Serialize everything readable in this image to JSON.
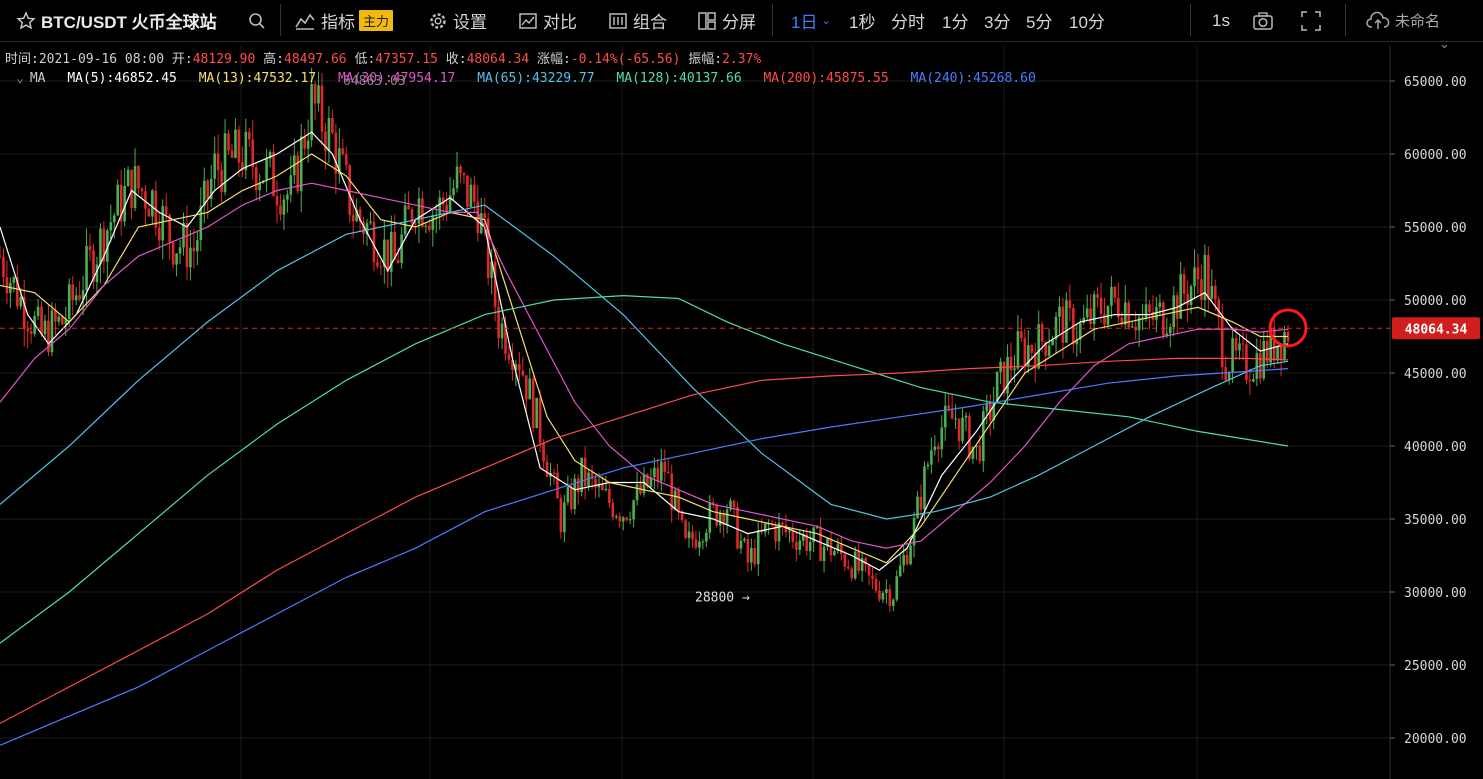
{
  "toolbar": {
    "symbol": "BTC/USDT 火币全球站",
    "indicator_label": "指标",
    "indicator_badge": "主力",
    "settings_label": "设置",
    "compare_label": "对比",
    "combine_label": "组合",
    "split_label": "分屏",
    "intervals": [
      "1日",
      "1秒",
      "分时",
      "1分",
      "3分",
      "5分",
      "10分"
    ],
    "active_interval": "1日",
    "refresh_label": "1s",
    "cloud_label": "未命名"
  },
  "info": {
    "time_label": "时间:",
    "time": "2021-09-16 08:00",
    "open_label": "开:",
    "open": "48129.90",
    "high_label": "高:",
    "high": "48497.66",
    "low_label": "低:",
    "low": "47357.15",
    "close_label": "收:",
    "close": "48064.34",
    "change_label": "涨幅:",
    "change": "-0.14%(-65.56)",
    "amp_label": "振幅:",
    "amp": "2.37%"
  },
  "ma_legend": {
    "title": "MA",
    "items": [
      {
        "label": "MA(5):46852.45",
        "color": "#ffffff"
      },
      {
        "label": "MA(13):47532.17",
        "color": "#f5e06e"
      },
      {
        "label": "MA(30):47954.17",
        "color": "#e056c8"
      },
      {
        "label": "MA(65):43229.77",
        "color": "#4fc3e8"
      },
      {
        "label": "MA(128):40137.66",
        "color": "#4fe0a0"
      },
      {
        "label": "MA(200):45875.55",
        "color": "#ff4a4a"
      },
      {
        "label": "MA(240):45268.60",
        "color": "#4a7cff"
      }
    ]
  },
  "colors": {
    "up": "#4caf50",
    "down": "#e02828",
    "grid": "#1d1d1d",
    "current_price": "#e02828"
  },
  "chart_data": {
    "type": "candlestick",
    "y_axis_ticks": [
      20000,
      25000,
      30000,
      35000,
      40000,
      45000,
      50000,
      55000,
      60000,
      65000
    ],
    "y_axis_labels": [
      "20000.00",
      "25000.00",
      "30000.00",
      "35000.00",
      "40000.00",
      "45000.00",
      "50000.00",
      "55000.00",
      "60000.00",
      "65000.00"
    ],
    "ylim": [
      17700,
      67800
    ],
    "current_price": 48064.34,
    "current_price_label": "48064.34",
    "min_marker": {
      "label": "28800 →",
      "value": 28800
    },
    "max_marker": {
      "label": "64863.03",
      "value": 64863
    },
    "ohlc_ref": [
      [
        0,
        53000
      ],
      [
        6,
        50000
      ],
      [
        12,
        47500
      ],
      [
        18,
        48500
      ],
      [
        25,
        52000
      ],
      [
        32,
        55500
      ],
      [
        38,
        58000
      ],
      [
        44,
        57000
      ],
      [
        50,
        54000
      ],
      [
        56,
        53500
      ],
      [
        62,
        59000
      ],
      [
        70,
        60000
      ],
      [
        78,
        58500
      ],
      [
        84,
        57000
      ],
      [
        90,
        63500
      ],
      [
        96,
        61000
      ],
      [
        102,
        56000
      ],
      [
        108,
        54500
      ],
      [
        114,
        52500
      ],
      [
        120,
        57000
      ],
      [
        126,
        56000
      ],
      [
        132,
        58000
      ],
      [
        138,
        56500
      ],
      [
        144,
        48500
      ],
      [
        150,
        46000
      ],
      [
        156,
        41000
      ],
      [
        162,
        35000
      ],
      [
        168,
        38000
      ],
      [
        174,
        36500
      ],
      [
        180,
        35500
      ],
      [
        186,
        37000
      ],
      [
        192,
        38500
      ],
      [
        198,
        33000
      ],
      [
        204,
        35000
      ],
      [
        210,
        36000
      ],
      [
        216,
        32000
      ],
      [
        222,
        34500
      ],
      [
        228,
        34000
      ],
      [
        234,
        33500
      ],
      [
        240,
        33000
      ],
      [
        246,
        32000
      ],
      [
        252,
        30500
      ],
      [
        258,
        30000
      ],
      [
        264,
        34500
      ],
      [
        270,
        41000
      ],
      [
        276,
        42000
      ],
      [
        282,
        39500
      ],
      [
        288,
        44000
      ],
      [
        294,
        46500
      ],
      [
        300,
        47000
      ],
      [
        306,
        48500
      ],
      [
        312,
        48000
      ],
      [
        318,
        49500
      ],
      [
        324,
        50000
      ],
      [
        330,
        48500
      ],
      [
        336,
        49000
      ],
      [
        342,
        50500
      ],
      [
        348,
        52000
      ],
      [
        354,
        46000
      ],
      [
        360,
        45500
      ],
      [
        366,
        46500
      ],
      [
        372,
        48000
      ]
    ],
    "series": [
      {
        "name": "MA(5)",
        "color": "#ffffff",
        "values": [
          [
            0,
            55000
          ],
          [
            8,
            49000
          ],
          [
            14,
            47000
          ],
          [
            22,
            49000
          ],
          [
            30,
            53000
          ],
          [
            38,
            57500
          ],
          [
            46,
            56000
          ],
          [
            54,
            55000
          ],
          [
            62,
            57500
          ],
          [
            70,
            59000
          ],
          [
            80,
            60000
          ],
          [
            90,
            61500
          ],
          [
            96,
            60000
          ],
          [
            104,
            55500
          ],
          [
            112,
            52000
          ],
          [
            120,
            55500
          ],
          [
            130,
            57000
          ],
          [
            140,
            55000
          ],
          [
            148,
            46000
          ],
          [
            156,
            38500
          ],
          [
            166,
            37000
          ],
          [
            176,
            37500
          ],
          [
            186,
            37500
          ],
          [
            196,
            35500
          ],
          [
            206,
            35000
          ],
          [
            216,
            34000
          ],
          [
            226,
            34500
          ],
          [
            236,
            33500
          ],
          [
            246,
            32500
          ],
          [
            254,
            31500
          ],
          [
            262,
            33000
          ],
          [
            272,
            38000
          ],
          [
            282,
            41000
          ],
          [
            292,
            44500
          ],
          [
            302,
            47000
          ],
          [
            312,
            48500
          ],
          [
            322,
            49000
          ],
          [
            332,
            49000
          ],
          [
            340,
            49500
          ],
          [
            348,
            50500
          ],
          [
            356,
            48000
          ],
          [
            364,
            46500
          ],
          [
            372,
            47000
          ]
        ]
      },
      {
        "name": "MA(13)",
        "color": "#f5e06e",
        "values": [
          [
            0,
            51000
          ],
          [
            10,
            50500
          ],
          [
            20,
            48500
          ],
          [
            30,
            51000
          ],
          [
            40,
            55000
          ],
          [
            50,
            55500
          ],
          [
            60,
            56000
          ],
          [
            70,
            57500
          ],
          [
            80,
            58500
          ],
          [
            90,
            60000
          ],
          [
            100,
            58500
          ],
          [
            110,
            55500
          ],
          [
            120,
            55000
          ],
          [
            130,
            56000
          ],
          [
            140,
            55500
          ],
          [
            150,
            48000
          ],
          [
            158,
            42000
          ],
          [
            166,
            39000
          ],
          [
            176,
            37500
          ],
          [
            186,
            37000
          ],
          [
            196,
            36500
          ],
          [
            206,
            35500
          ],
          [
            216,
            35000
          ],
          [
            226,
            34500
          ],
          [
            236,
            34000
          ],
          [
            246,
            33000
          ],
          [
            256,
            32000
          ],
          [
            266,
            34500
          ],
          [
            276,
            38000
          ],
          [
            286,
            41500
          ],
          [
            296,
            45000
          ],
          [
            306,
            46500
          ],
          [
            316,
            48000
          ],
          [
            326,
            48500
          ],
          [
            336,
            49000
          ],
          [
            346,
            49500
          ],
          [
            356,
            48500
          ],
          [
            364,
            47500
          ],
          [
            372,
            47500
          ]
        ]
      },
      {
        "name": "MA(30)",
        "color": "#e056c8",
        "values": [
          [
            0,
            43000
          ],
          [
            10,
            46000
          ],
          [
            20,
            48000
          ],
          [
            30,
            51000
          ],
          [
            40,
            53000
          ],
          [
            50,
            54000
          ],
          [
            60,
            55000
          ],
          [
            70,
            56500
          ],
          [
            80,
            57500
          ],
          [
            90,
            58000
          ],
          [
            100,
            57500
          ],
          [
            110,
            57000
          ],
          [
            120,
            56500
          ],
          [
            130,
            56000
          ],
          [
            138,
            56000
          ],
          [
            146,
            52000
          ],
          [
            156,
            47500
          ],
          [
            166,
            43000
          ],
          [
            176,
            40000
          ],
          [
            186,
            38000
          ],
          [
            196,
            37000
          ],
          [
            206,
            36000
          ],
          [
            216,
            35500
          ],
          [
            226,
            35000
          ],
          [
            236,
            34500
          ],
          [
            246,
            33500
          ],
          [
            256,
            33000
          ],
          [
            266,
            33500
          ],
          [
            276,
            35500
          ],
          [
            286,
            37500
          ],
          [
            296,
            40000
          ],
          [
            306,
            43000
          ],
          [
            316,
            45500
          ],
          [
            326,
            47000
          ],
          [
            336,
            47500
          ],
          [
            346,
            48000
          ],
          [
            356,
            48000
          ],
          [
            364,
            47800
          ],
          [
            372,
            48000
          ]
        ]
      },
      {
        "name": "MA(65)",
        "color": "#4fc3e8",
        "values": [
          [
            0,
            36000
          ],
          [
            20,
            40000
          ],
          [
            40,
            44500
          ],
          [
            60,
            48500
          ],
          [
            80,
            52000
          ],
          [
            100,
            54500
          ],
          [
            120,
            55500
          ],
          [
            140,
            56500
          ],
          [
            160,
            53000
          ],
          [
            180,
            49000
          ],
          [
            200,
            44000
          ],
          [
            220,
            39500
          ],
          [
            240,
            36000
          ],
          [
            256,
            35000
          ],
          [
            270,
            35500
          ],
          [
            286,
            36500
          ],
          [
            300,
            38000
          ],
          [
            316,
            40000
          ],
          [
            332,
            42000
          ],
          [
            350,
            44000
          ],
          [
            364,
            45500
          ],
          [
            372,
            45800
          ]
        ]
      },
      {
        "name": "MA(128)",
        "color": "#4fe0a0",
        "values": [
          [
            0,
            26500
          ],
          [
            20,
            30000
          ],
          [
            40,
            34000
          ],
          [
            60,
            38000
          ],
          [
            80,
            41500
          ],
          [
            100,
            44500
          ],
          [
            120,
            47000
          ],
          [
            140,
            49000
          ],
          [
            160,
            50000
          ],
          [
            180,
            50300
          ],
          [
            196,
            50100
          ],
          [
            210,
            48500
          ],
          [
            226,
            47000
          ],
          [
            246,
            45500
          ],
          [
            266,
            44000
          ],
          [
            286,
            43000
          ],
          [
            306,
            42500
          ],
          [
            326,
            42000
          ],
          [
            346,
            41000
          ],
          [
            372,
            40000
          ]
        ]
      },
      {
        "name": "MA(200)",
        "color": "#ff4a4a",
        "values": [
          [
            0,
            21000
          ],
          [
            20,
            23500
          ],
          [
            40,
            26000
          ],
          [
            60,
            28500
          ],
          [
            80,
            31500
          ],
          [
            100,
            34000
          ],
          [
            120,
            36500
          ],
          [
            140,
            38500
          ],
          [
            160,
            40500
          ],
          [
            180,
            42000
          ],
          [
            200,
            43500
          ],
          [
            220,
            44500
          ],
          [
            240,
            44800
          ],
          [
            260,
            45000
          ],
          [
            280,
            45300
          ],
          [
            300,
            45500
          ],
          [
            320,
            45800
          ],
          [
            340,
            46000
          ],
          [
            360,
            46000
          ],
          [
            372,
            45900
          ]
        ]
      },
      {
        "name": "MA(240)",
        "color": "#4a7cff",
        "values": [
          [
            0,
            19500
          ],
          [
            20,
            21500
          ],
          [
            40,
            23500
          ],
          [
            60,
            26000
          ],
          [
            80,
            28500
          ],
          [
            100,
            31000
          ],
          [
            120,
            33000
          ],
          [
            140,
            35500
          ],
          [
            160,
            37000
          ],
          [
            180,
            38500
          ],
          [
            200,
            39500
          ],
          [
            220,
            40500
          ],
          [
            240,
            41300
          ],
          [
            260,
            42000
          ],
          [
            280,
            42700
          ],
          [
            300,
            43500
          ],
          [
            320,
            44300
          ],
          [
            340,
            44800
          ],
          [
            360,
            45100
          ],
          [
            372,
            45300
          ]
        ]
      }
    ]
  }
}
